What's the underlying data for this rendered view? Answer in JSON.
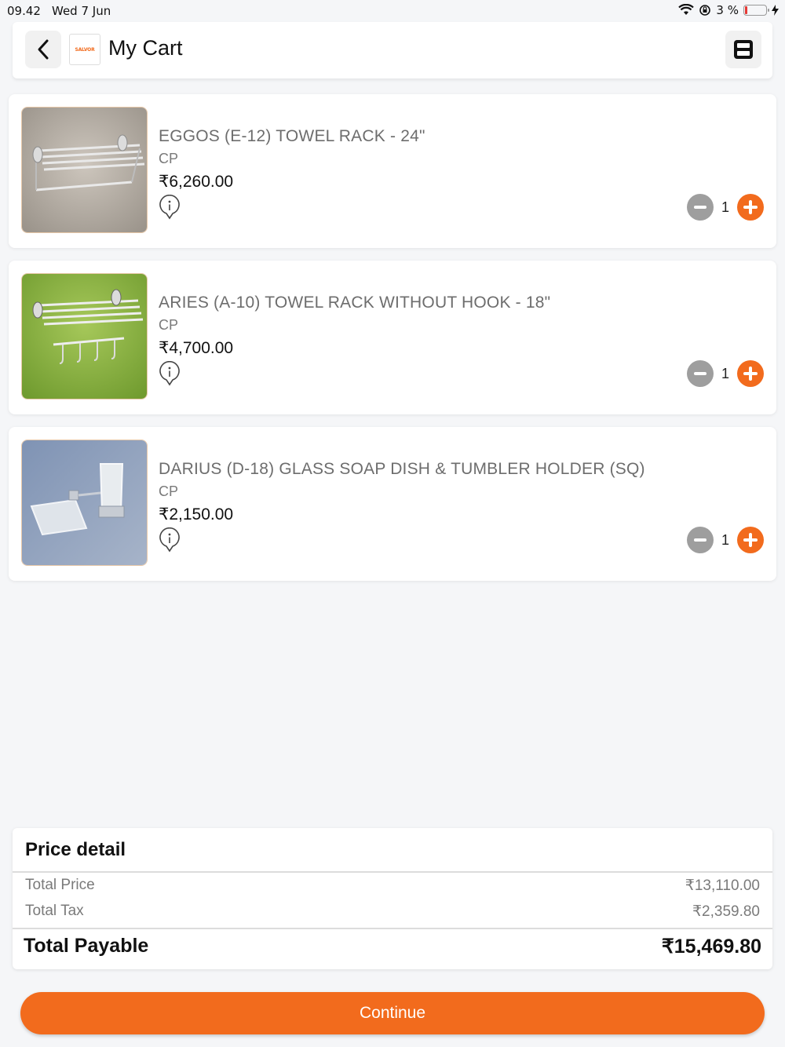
{
  "status_bar": {
    "time": "09.42",
    "date": "Wed 7 Jun",
    "battery": "3 %",
    "battery_level_percent": 3,
    "icons": [
      "wifi-icon",
      "orientation-lock-icon",
      "battery-icon",
      "charging-icon"
    ]
  },
  "header": {
    "title": "My Cart",
    "logo_text": "SALVOR",
    "back_icon": "chevron-left-icon",
    "scan_icon": "scan-icon"
  },
  "cart": {
    "items": [
      {
        "name": "EGGOS (E-12) TOWEL RACK - 24\"",
        "variant": "CP",
        "price": "₹6,260.00",
        "quantity": "1"
      },
      {
        "name": "ARIES (A-10) TOWEL RACK WITHOUT HOOK - 18\"",
        "variant": "CP",
        "price": "₹4,700.00",
        "quantity": "1"
      },
      {
        "name": "DARIUS (D-18) GLASS SOAP DISH & TUMBLER HOLDER (SQ)",
        "variant": "CP",
        "price": "₹2,150.00",
        "quantity": "1"
      }
    ]
  },
  "price_detail": {
    "heading": "Price detail",
    "total_price_label": "Total Price",
    "total_price_value": "₹13,110.00",
    "total_tax_label": "Total Tax",
    "total_tax_value": "₹2,359.80",
    "total_payable_label": "Total Payable",
    "total_payable_value": "₹15,469.80"
  },
  "actions": {
    "continue_label": "Continue"
  },
  "colors": {
    "accent": "#f26b1d",
    "minus": "#9e9e9e",
    "background": "#f5f6f8"
  }
}
